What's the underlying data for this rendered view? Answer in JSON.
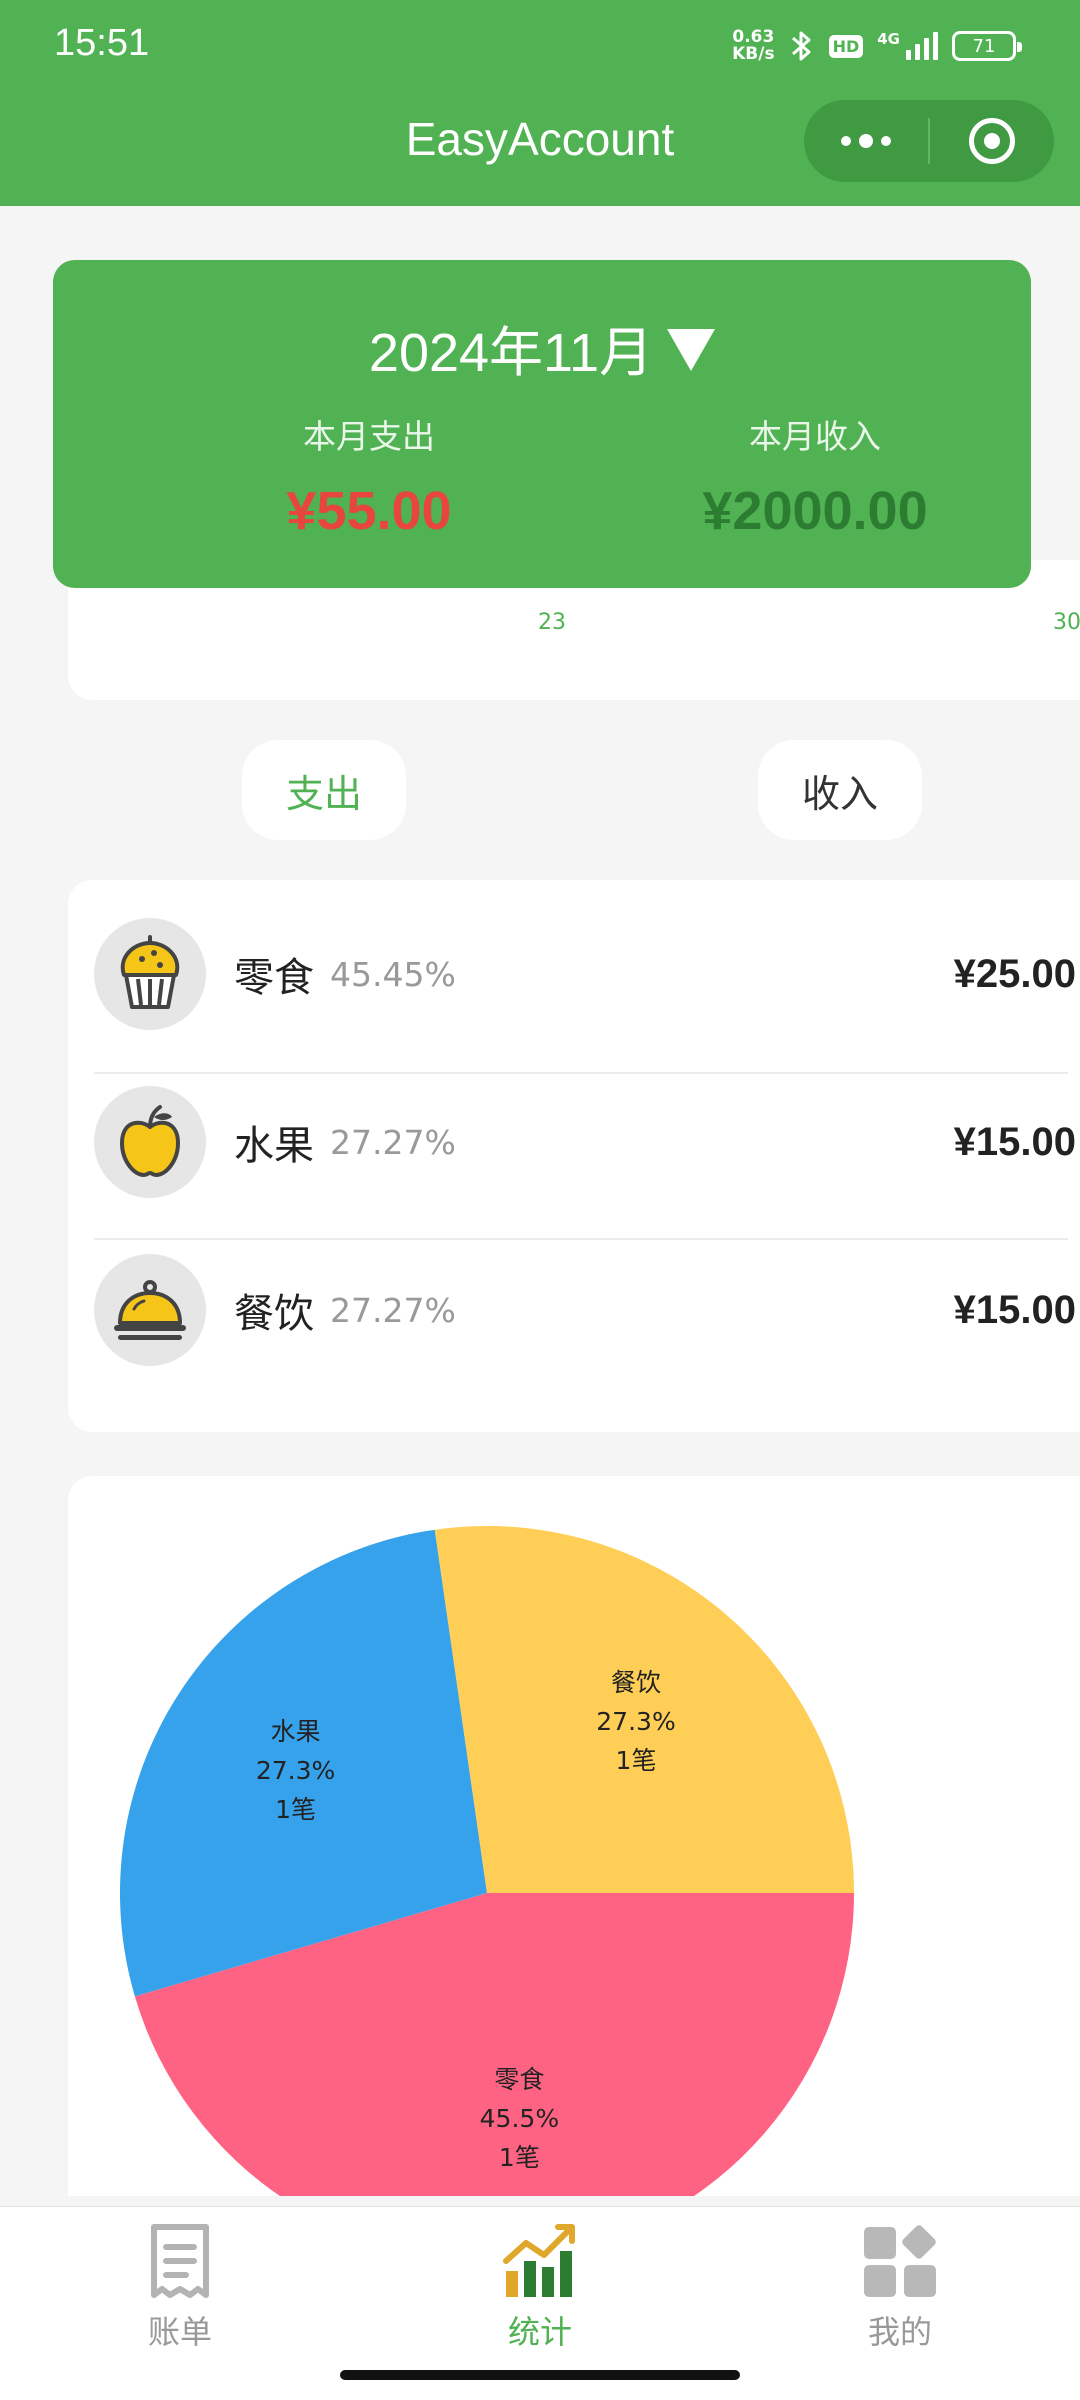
{
  "status_bar": {
    "time": "15:51",
    "net_speed_value": "0.63",
    "net_speed_unit": "KB/s",
    "hd": "HD",
    "network": "4G",
    "battery": "71"
  },
  "header": {
    "title": "EasyAccount"
  },
  "summary": {
    "month": "2024年11月",
    "expense_label": "本月支出",
    "expense_value": "¥55.00",
    "income_label": "本月收入",
    "income_value": "¥2000.00",
    "expense_color": "#e8453c",
    "income_color": "#2c7d31"
  },
  "background_chart": {
    "visible_ticks": [
      "23",
      "30"
    ]
  },
  "toggle": {
    "expense_label": "支出",
    "income_label": "收入",
    "active": "expense"
  },
  "categories": [
    {
      "name": "零食",
      "percent": "45.45%",
      "amount": "¥25.00",
      "icon": "cupcake-icon"
    },
    {
      "name": "水果",
      "percent": "27.27%",
      "amount": "¥15.00",
      "icon": "apple-icon"
    },
    {
      "name": "餐饮",
      "percent": "27.27%",
      "amount": "¥15.00",
      "icon": "food-cloche-icon"
    }
  ],
  "chart_data": {
    "type": "pie",
    "title": "",
    "slices": [
      {
        "name": "零食",
        "value": 25,
        "percent_label": "45.5%",
        "count_label": "1笔",
        "color": "#ff6384"
      },
      {
        "name": "水果",
        "value": 15,
        "percent_label": "27.3%",
        "count_label": "1笔",
        "color": "#36a2eb"
      },
      {
        "name": "餐饮",
        "value": 15,
        "percent_label": "27.3%",
        "count_label": "1笔",
        "color": "#ffce56"
      }
    ]
  },
  "tabbar": {
    "items": [
      {
        "label": "账单",
        "icon": "receipt-icon",
        "active": false
      },
      {
        "label": "统计",
        "icon": "chart-icon",
        "active": true
      },
      {
        "label": "我的",
        "icon": "grid-icon",
        "active": false
      }
    ],
    "accent": "#50b252"
  }
}
